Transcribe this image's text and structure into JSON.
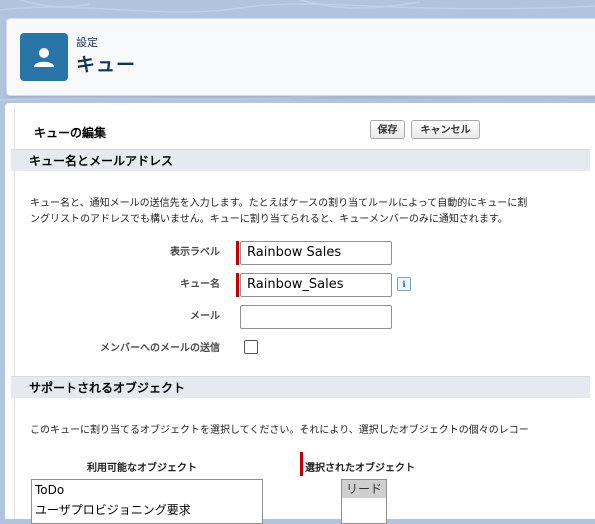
{
  "header": {
    "breadcrumb": "設定",
    "title": "キュー",
    "icon": "user-icon",
    "icon_color": "#2a75a8"
  },
  "panel": {
    "title": "キューの編集",
    "save_label": "保存",
    "cancel_label": "キャンセル"
  },
  "section_queue": {
    "title": "キュー名とメールアドレス",
    "desc_line1": "キュー名と、通知メールの送信先を入力します。たとえばケースの割り当てルールによって自動的にキューに割",
    "desc_line2": "ングリストのアドレスでも構いません。キューに割り当てられると、キューメンバーのみに通知されます。",
    "fields": {
      "display_label": "表示ラベル",
      "display_value": "Rainbow Sales",
      "queue_name_label": "キュー名",
      "queue_name_value": "Rainbow_Sales",
      "email_label": "メール",
      "email_value": "",
      "send_email_label": "メンバーへのメールの送信",
      "send_email_checked": false
    },
    "required_color": "#c00000"
  },
  "section_objects": {
    "title": "サポートされるオブジェクト",
    "desc": "このキューに割り当てるオブジェクトを選択してください。それにより、選択したオブジェクトの個々のレコー",
    "available_label": "利用可能なオブジェクト",
    "available_items": [
      "ToDo",
      "ユーザプロビジョニング要求"
    ],
    "selected_label": "選択されたオブジェクト",
    "selected_items": [
      "リード"
    ]
  }
}
